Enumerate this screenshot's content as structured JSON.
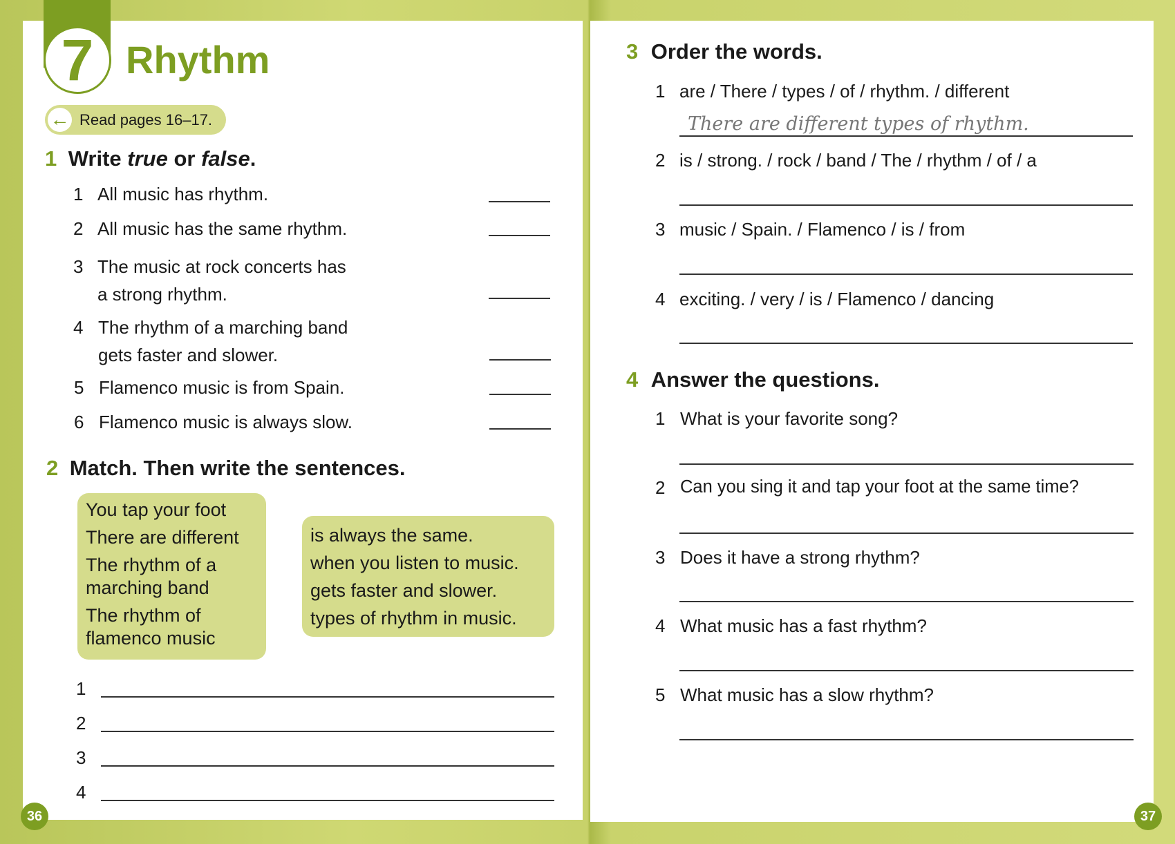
{
  "unit": {
    "number": "7",
    "title": "Rhythm",
    "read_pages": "Read pages 16–17."
  },
  "ex1": {
    "number": "1",
    "heading_a": "Write ",
    "heading_b": "true",
    "heading_c": " or ",
    "heading_d": "false",
    "heading_e": ".",
    "items": [
      {
        "n": "1",
        "l1": "All music has rhythm.",
        "l2": ""
      },
      {
        "n": "2",
        "l1": "All music has the same rhythm.",
        "l2": ""
      },
      {
        "n": "3",
        "l1": "The music at rock concerts has",
        "l2": "a strong rhythm."
      },
      {
        "n": "4",
        "l1": "The rhythm of a marching band",
        "l2": "gets faster and slower."
      },
      {
        "n": "5",
        "l1": "Flamenco music is from Spain.",
        "l2": ""
      },
      {
        "n": "6",
        "l1": "Flamenco music is always slow.",
        "l2": ""
      }
    ]
  },
  "ex2": {
    "number": "2",
    "heading": "Match. Then write the sentences.",
    "left": [
      "You tap your foot",
      "There are different",
      "The rhythm of a",
      "marching band",
      "The rhythm of",
      "flamenco music"
    ],
    "right": [
      "is always the same.",
      "when you listen to music.",
      "gets faster and slower.",
      "types of rhythm in music."
    ],
    "lines": [
      "1",
      "2",
      "3",
      "4"
    ]
  },
  "ex3": {
    "number": "3",
    "heading": "Order the words.",
    "items": [
      {
        "n": "1",
        "text": "are / There / types / of / rhythm. / different",
        "answer": "There are different types of rhythm."
      },
      {
        "n": "2",
        "text": "is / strong. / rock / band / The / rhythm / of / a",
        "answer": ""
      },
      {
        "n": "3",
        "text": "music / Spain. / Flamenco / is / from",
        "answer": ""
      },
      {
        "n": "4",
        "text": "exciting. / very / is / Flamenco / dancing",
        "answer": ""
      }
    ]
  },
  "ex4": {
    "number": "4",
    "heading": "Answer the questions.",
    "items": [
      {
        "n": "1",
        "text": "What is your favorite song?"
      },
      {
        "n": "2",
        "text": "Can you sing it and tap your foot at the same time?"
      },
      {
        "n": "3",
        "text": "Does it have a strong rhythm?"
      },
      {
        "n": "4",
        "text": "What music has a fast rhythm?"
      },
      {
        "n": "5",
        "text": "What music has a slow rhythm?"
      }
    ]
  },
  "pages": {
    "left": "36",
    "right": "37"
  },
  "colors": {
    "accent": "#7d9e22",
    "box": "#d5dc8c"
  }
}
